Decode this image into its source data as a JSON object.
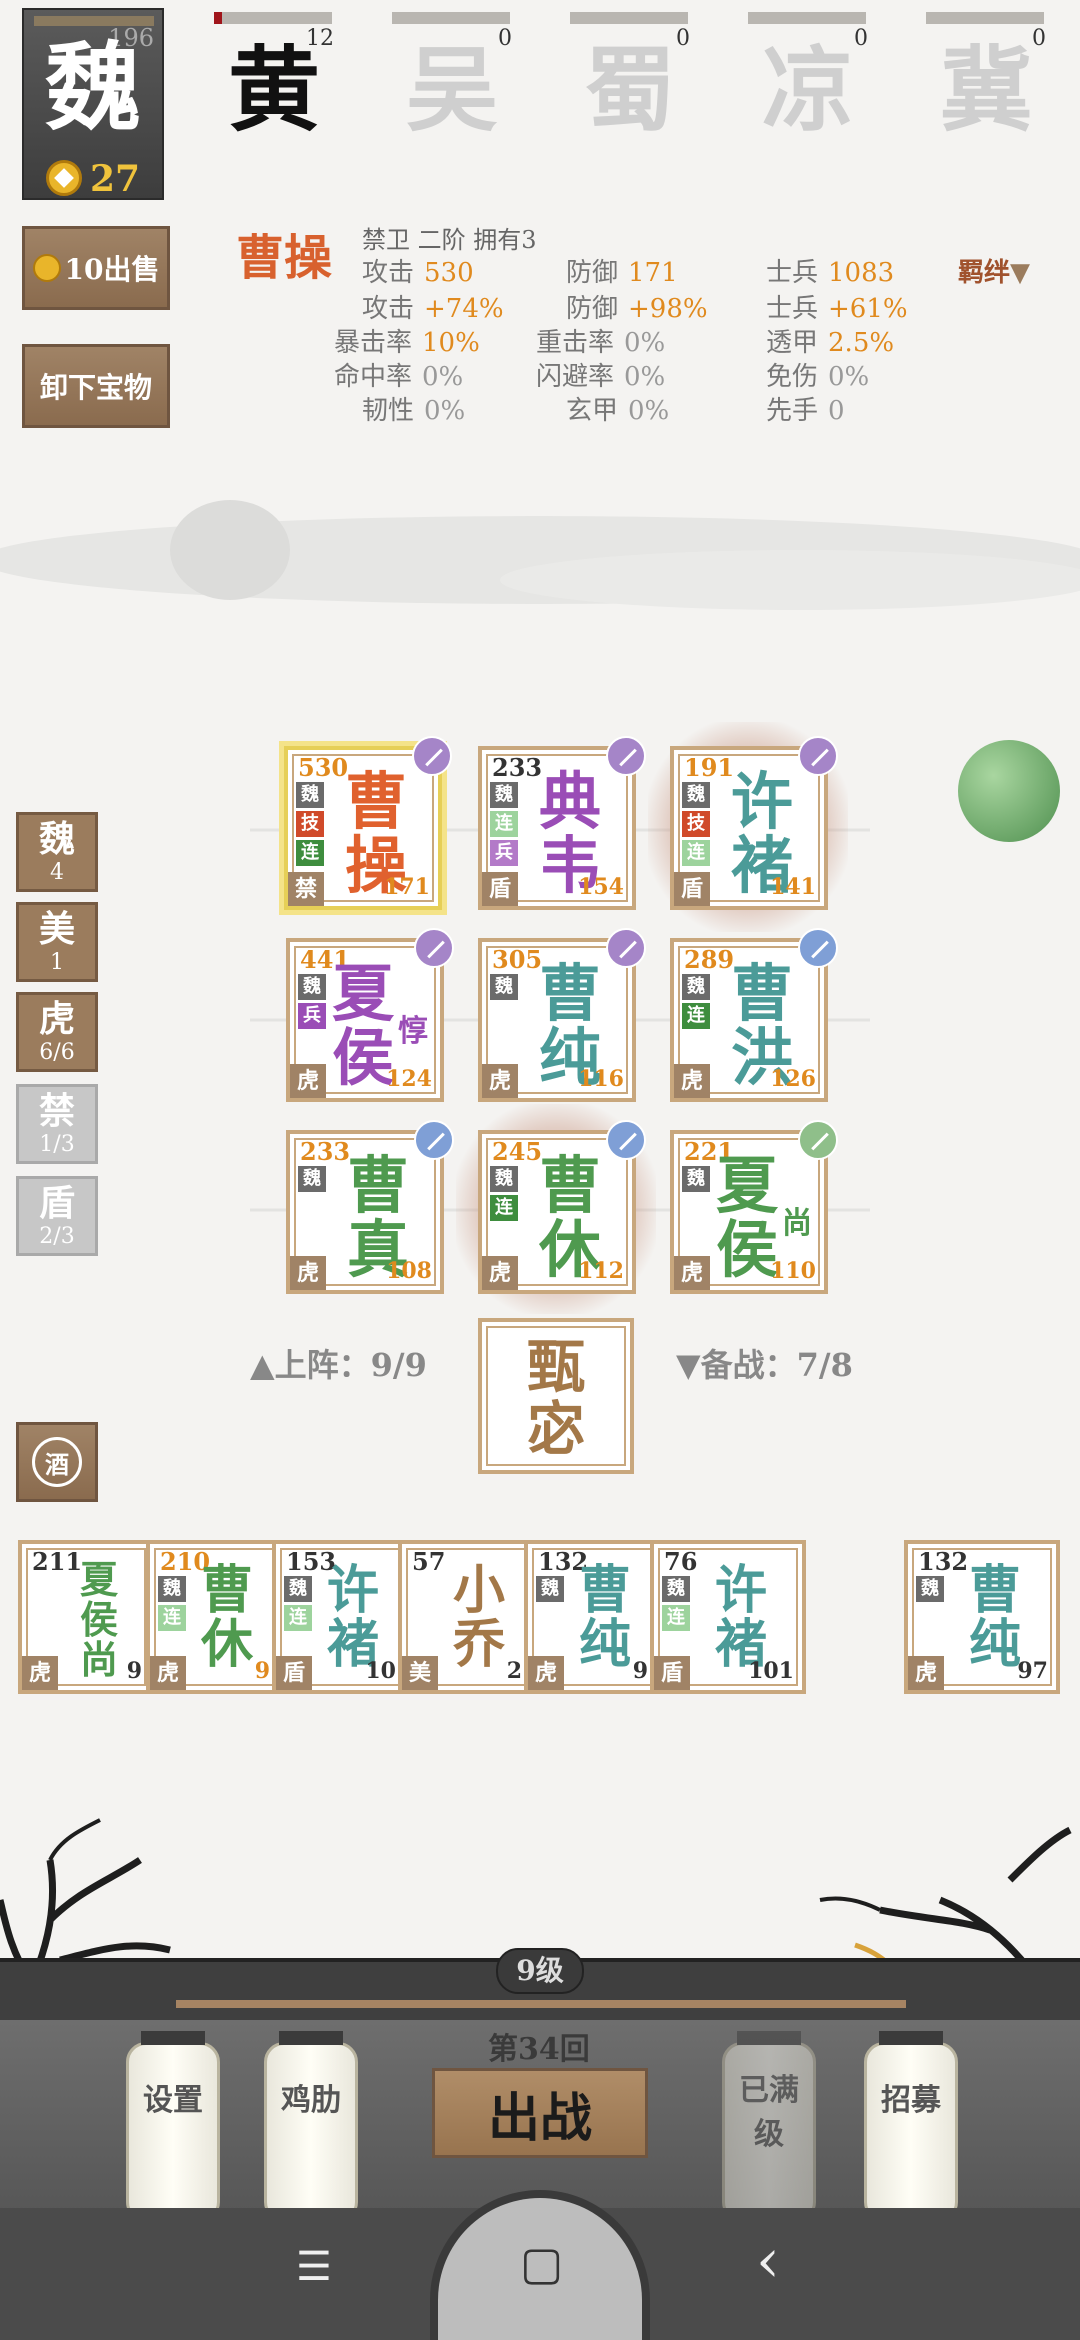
{
  "faction_current": {
    "name": "魏",
    "level": "196",
    "gold": "27"
  },
  "factions": [
    {
      "name": "黄",
      "count": "12",
      "color": "#111111",
      "progress": 0.06
    },
    {
      "name": "吴",
      "count": "0",
      "color": "#cfcfcf",
      "progress": 0
    },
    {
      "name": "蜀",
      "count": "0",
      "color": "#cfcfcf",
      "progress": 0
    },
    {
      "name": "凉",
      "count": "0",
      "color": "#cfcfcf",
      "progress": 0
    },
    {
      "name": "冀",
      "count": "0",
      "color": "#cfcfcf",
      "progress": 0
    }
  ],
  "buttons": {
    "sell": "10出售",
    "unequip": "卸下宝物",
    "bond": "羁绊",
    "fight": "出战"
  },
  "hero": {
    "name": "曹操",
    "info": "禁卫  二阶  拥有3",
    "stats": [
      {
        "label": "攻击",
        "value": "530"
      },
      {
        "label": "防御",
        "value": "171"
      },
      {
        "label": "士兵",
        "value": "1083"
      },
      {
        "label": "攻击",
        "value": "+74%"
      },
      {
        "label": "防御",
        "value": "+98%"
      },
      {
        "label": "士兵",
        "value": "+61%"
      },
      {
        "label": "暴击率",
        "value": "10%"
      },
      {
        "label": "重击率",
        "value": "0%"
      },
      {
        "label": "透甲",
        "value": "2.5%"
      },
      {
        "label": "命中率",
        "value": "0%"
      },
      {
        "label": "闪避率",
        "value": "0%"
      },
      {
        "label": "免伤",
        "value": "0%"
      },
      {
        "label": "韧性",
        "value": "0%"
      },
      {
        "label": "玄甲",
        "value": "0%"
      },
      {
        "label": "先手",
        "value": "0"
      }
    ]
  },
  "tallies": [
    {
      "name": "魏",
      "count": "4"
    },
    {
      "name": "美",
      "count": "1"
    },
    {
      "name": "虎",
      "count": "6/6"
    },
    {
      "name": "禁",
      "count": "1/3"
    },
    {
      "name": "盾",
      "count": "2/3"
    }
  ],
  "formation": [
    {
      "name1": "曹",
      "name2": "操",
      "atk": "530",
      "def": "171",
      "type": "禁",
      "tags": [
        "魏",
        "技",
        "连"
      ]
    },
    {
      "name1": "典",
      "name2": "韦",
      "atk": "233",
      "def": "154",
      "type": "盾",
      "tags": [
        "魏",
        "连",
        "兵"
      ]
    },
    {
      "name1": "许",
      "name2": "褚",
      "atk": "191",
      "def": "141",
      "type": "盾",
      "tags": [
        "魏",
        "技",
        "连"
      ]
    },
    {
      "name1": "夏",
      "name2": "侯",
      "small": "惇",
      "atk": "441",
      "def": "124",
      "type": "虎",
      "tags": [
        "魏",
        "兵"
      ]
    },
    {
      "name1": "曹",
      "name2": "纯",
      "atk": "305",
      "def": "116",
      "type": "虎",
      "tags": [
        "魏"
      ]
    },
    {
      "name1": "曹",
      "name2": "洪",
      "atk": "289",
      "def": "126",
      "type": "虎",
      "tags": [
        "魏",
        "连"
      ]
    },
    {
      "name1": "曹",
      "name2": "真",
      "atk": "233",
      "def": "108",
      "type": "虎",
      "tags": [
        "魏"
      ]
    },
    {
      "name1": "曹",
      "name2": "休",
      "atk": "245",
      "def": "112",
      "type": "虎",
      "tags": [
        "魏",
        "连"
      ]
    },
    {
      "name1": "夏",
      "name2": "侯",
      "small": "尚",
      "atk": "221",
      "def": "110",
      "type": "虎",
      "tags": [
        "魏"
      ]
    }
  ],
  "deploy": {
    "on": "▲上阵：9/9",
    "reserve": "▼备战：7/8",
    "chief1": "甄",
    "chief2": "宓"
  },
  "wine": "酒",
  "bench": [
    {
      "name1": "夏",
      "name2": "侯",
      "name3": "尚",
      "atk": "211",
      "def": "9",
      "type": "虎",
      "tags": [
        "魏"
      ]
    },
    {
      "name1": "曹",
      "name2": "休",
      "atk": "210",
      "def": "9",
      "type": "虎",
      "tags": [
        "魏",
        "连"
      ]
    },
    {
      "name1": "许",
      "name2": "褚",
      "atk": "153",
      "def": "10",
      "type": "盾",
      "tags": [
        "魏",
        "连"
      ]
    },
    {
      "name1": "小",
      "name2": "乔",
      "atk": "57",
      "def": "2",
      "type": "美",
      "tags": []
    },
    {
      "name1": "曹",
      "name2": "纯",
      "atk": "132",
      "def": "9",
      "type": "虎",
      "tags": [
        "魏"
      ]
    },
    {
      "name1": "许",
      "name2": "褚",
      "atk": "76",
      "def": "101",
      "type": "盾",
      "tags": [
        "魏",
        "连"
      ]
    },
    {
      "name1": "曹",
      "name2": "纯",
      "atk": "132",
      "def": "97",
      "type": "虎",
      "tags": [
        "魏"
      ]
    }
  ],
  "bottom": {
    "level": "9级",
    "round": "第34回",
    "lanterns": [
      "设置",
      "鸡肋",
      "已满级",
      "招募"
    ]
  },
  "nav": {
    "menu": "☰",
    "home": "▢",
    "back": "‹"
  }
}
